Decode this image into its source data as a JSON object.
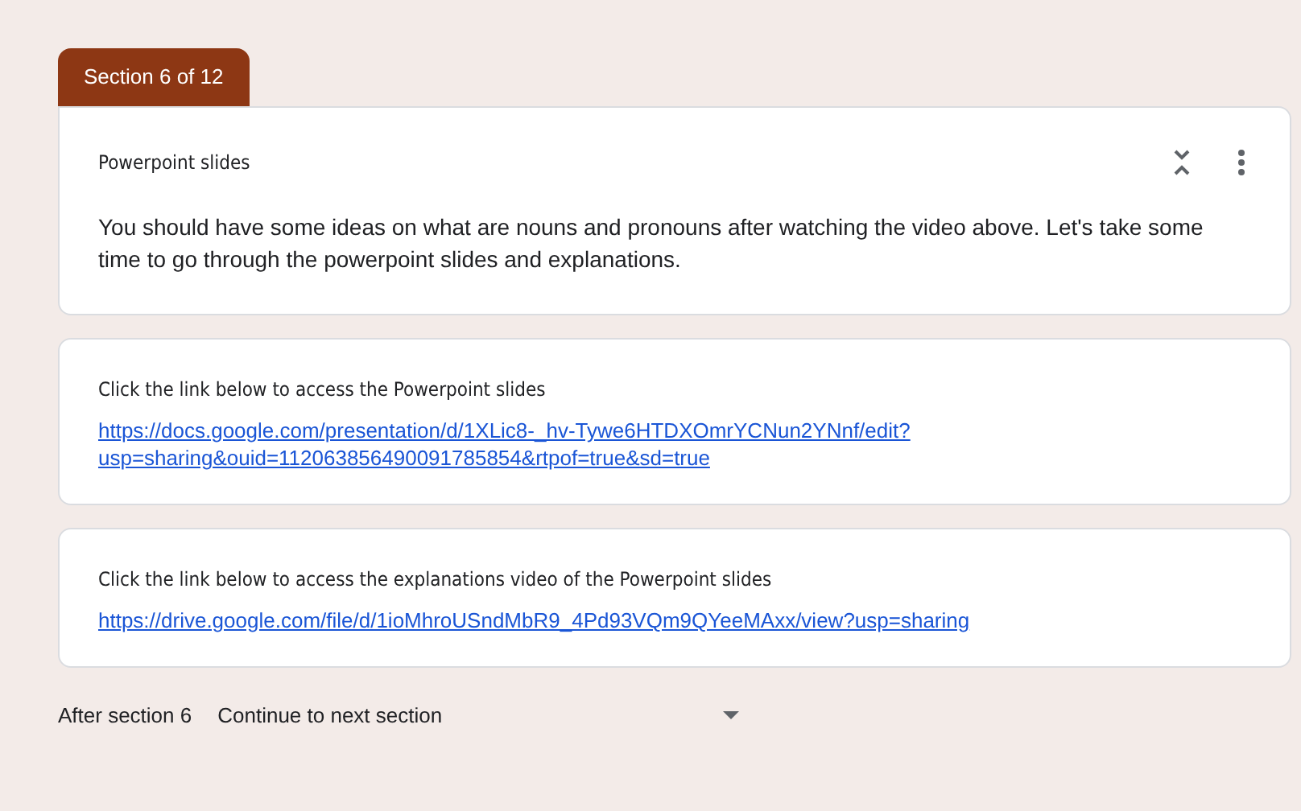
{
  "section_tab": {
    "label": "Section 6 of 12"
  },
  "header_card": {
    "title": "Powerpoint slides",
    "description": "You should have some ideas on what are nouns and pronouns after watching the video above. Let's take some time to go through the powerpoint slides and explanations.",
    "expanded": true
  },
  "items": [
    {
      "title": "Click the link below to access the Powerpoint slides",
      "link": "https://docs.google.com/presentation/d/1XLic8-_hv-Tywe6HTDXOmrYCNun2YNnf/edit?usp=sharing&ouid=112063856490091785854&rtpof=true&sd=true"
    },
    {
      "title": "Click the link below to access the explanations video of the Powerpoint slides",
      "link": "https://drive.google.com/file/d/1ioMhroUSndMbR9_4Pd93VQm9QYeeMAxx/view?usp=sharing"
    }
  ],
  "footer": {
    "label": "After section 6",
    "select_value": "Continue to next section"
  }
}
